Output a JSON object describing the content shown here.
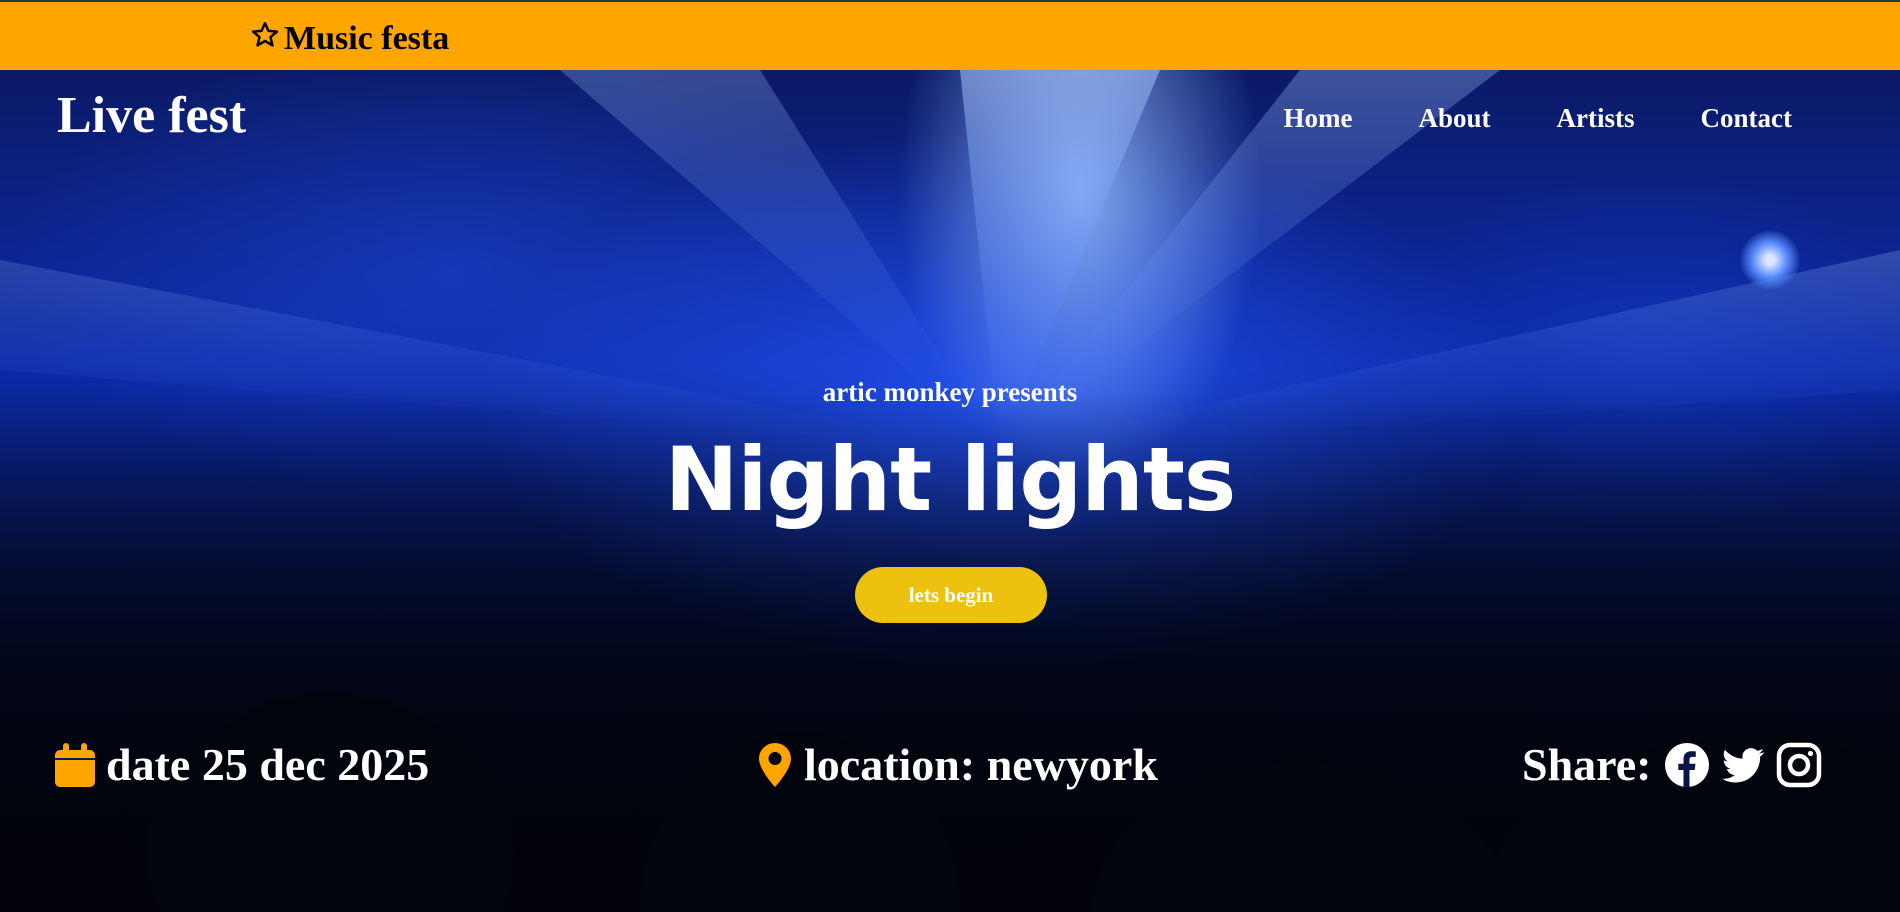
{
  "banner": {
    "brand": "Music festa",
    "icon": "star-outline-icon",
    "color": "#ffa500"
  },
  "header": {
    "logo": "Live fest",
    "nav": [
      "Home",
      "About",
      "Artists",
      "Contact"
    ]
  },
  "hero": {
    "presents": "artic monkey presents",
    "title": "Night lights",
    "cta_label": "lets begin",
    "cta_color": "#ecc10f"
  },
  "info": {
    "date": "date 25 dec 2025",
    "location": "location: newyork",
    "share_label": "Share:",
    "icon_color": "#ffa500",
    "share_icons": [
      "facebook-icon",
      "twitter-icon",
      "instagram-icon"
    ]
  }
}
